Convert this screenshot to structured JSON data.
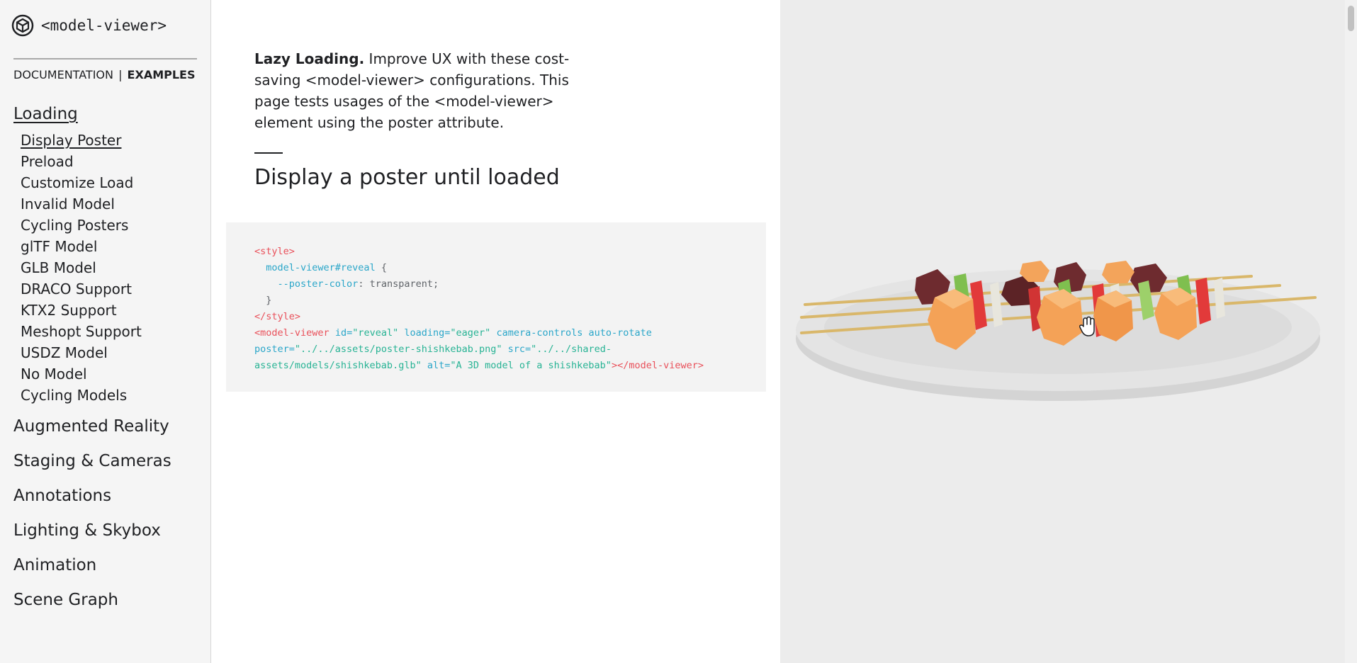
{
  "brand": {
    "name": "<model-viewer>"
  },
  "topnav": {
    "documentation": "DOCUMENTATION",
    "separator": "|",
    "examples": "EXAMPLES"
  },
  "sidebar": {
    "categories": [
      {
        "label": "Loading"
      },
      {
        "label": "Augmented Reality"
      },
      {
        "label": "Staging & Cameras"
      },
      {
        "label": "Annotations"
      },
      {
        "label": "Lighting & Skybox"
      },
      {
        "label": "Animation"
      },
      {
        "label": "Scene Graph"
      }
    ],
    "loading_items": [
      {
        "label": "Display Poster"
      },
      {
        "label": "Preload"
      },
      {
        "label": "Customize Load"
      },
      {
        "label": "Invalid Model"
      },
      {
        "label": "Cycling Posters"
      },
      {
        "label": "glTF Model"
      },
      {
        "label": "GLB Model"
      },
      {
        "label": "DRACO Support"
      },
      {
        "label": "KTX2 Support"
      },
      {
        "label": "Meshopt Support"
      },
      {
        "label": "USDZ Model"
      },
      {
        "label": "No Model"
      },
      {
        "label": "Cycling Models"
      }
    ]
  },
  "intro": {
    "lead": "Lazy Loading.",
    "body": " Improve UX with these cost-saving <model-viewer> configurations. This page tests usages of the <model-viewer> element using the poster attribute."
  },
  "section": {
    "title": "Display a poster until loaded"
  },
  "code": {
    "l1_tag": "<style>",
    "l2_sel": "model-viewer#reveal",
    "l2_brace": " {",
    "l3_prop": "--poster-color",
    "l3_rest": ": transparent;",
    "l4_brace": "}",
    "l5_tag": "</style>",
    "l6_tag": "<model-viewer",
    "l6_a1": "id=",
    "l6_v1": "\"reveal\"",
    "l6_a2": "loading=",
    "l6_v2": "\"eager\"",
    "l6_a3": "camera-controls auto-rotate",
    "l7_a1": "poster=",
    "l7_v1": "\"../../assets/poster-shishkebab.png\"",
    "l7_a2": "src=",
    "l7_v2": "\"../../shared-",
    "l8_v1": "assets/models/shishkebab.glb\"",
    "l8_a1": "alt=",
    "l8_v2": "\"A 3D model of a shishkebab\"",
    "l8_tag": "></model-viewer>"
  },
  "icons": {
    "logo": "model-viewer-cube-icon",
    "cursor": "hand-grab-cursor-icon"
  },
  "colors": {
    "sidebar_bg": "#f5f5f5",
    "viewer_bg": "#ececec",
    "code_bg": "#f3f3f3",
    "tag": "#e9505a",
    "attr": "#2aa6c9",
    "value": "#27b394"
  }
}
